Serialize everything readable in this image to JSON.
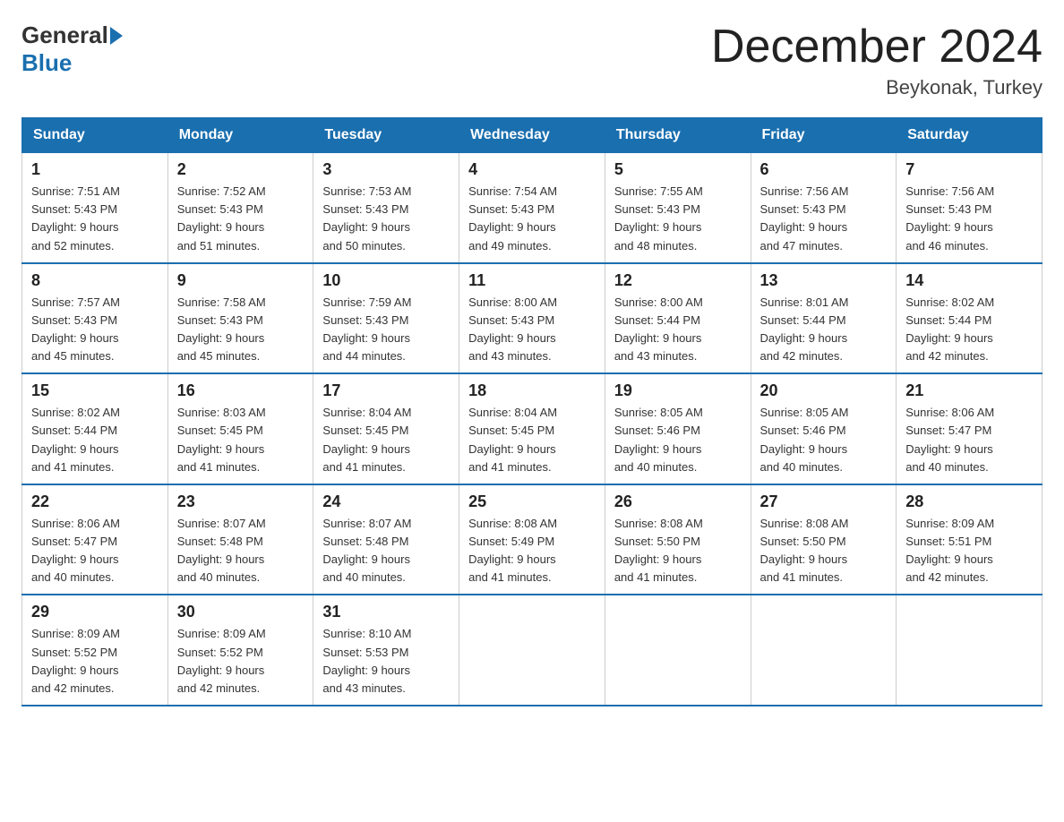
{
  "header": {
    "logo_general": "General",
    "logo_blue": "Blue",
    "month_title": "December 2024",
    "location": "Beykonak, Turkey"
  },
  "calendar": {
    "days_of_week": [
      "Sunday",
      "Monday",
      "Tuesday",
      "Wednesday",
      "Thursday",
      "Friday",
      "Saturday"
    ],
    "weeks": [
      [
        {
          "day": "1",
          "sunrise": "7:51 AM",
          "sunset": "5:43 PM",
          "daylight": "9 hours and 52 minutes."
        },
        {
          "day": "2",
          "sunrise": "7:52 AM",
          "sunset": "5:43 PM",
          "daylight": "9 hours and 51 minutes."
        },
        {
          "day": "3",
          "sunrise": "7:53 AM",
          "sunset": "5:43 PM",
          "daylight": "9 hours and 50 minutes."
        },
        {
          "day": "4",
          "sunrise": "7:54 AM",
          "sunset": "5:43 PM",
          "daylight": "9 hours and 49 minutes."
        },
        {
          "day": "5",
          "sunrise": "7:55 AM",
          "sunset": "5:43 PM",
          "daylight": "9 hours and 48 minutes."
        },
        {
          "day": "6",
          "sunrise": "7:56 AM",
          "sunset": "5:43 PM",
          "daylight": "9 hours and 47 minutes."
        },
        {
          "day": "7",
          "sunrise": "7:56 AM",
          "sunset": "5:43 PM",
          "daylight": "9 hours and 46 minutes."
        }
      ],
      [
        {
          "day": "8",
          "sunrise": "7:57 AM",
          "sunset": "5:43 PM",
          "daylight": "9 hours and 45 minutes."
        },
        {
          "day": "9",
          "sunrise": "7:58 AM",
          "sunset": "5:43 PM",
          "daylight": "9 hours and 45 minutes."
        },
        {
          "day": "10",
          "sunrise": "7:59 AM",
          "sunset": "5:43 PM",
          "daylight": "9 hours and 44 minutes."
        },
        {
          "day": "11",
          "sunrise": "8:00 AM",
          "sunset": "5:43 PM",
          "daylight": "9 hours and 43 minutes."
        },
        {
          "day": "12",
          "sunrise": "8:00 AM",
          "sunset": "5:44 PM",
          "daylight": "9 hours and 43 minutes."
        },
        {
          "day": "13",
          "sunrise": "8:01 AM",
          "sunset": "5:44 PM",
          "daylight": "9 hours and 42 minutes."
        },
        {
          "day": "14",
          "sunrise": "8:02 AM",
          "sunset": "5:44 PM",
          "daylight": "9 hours and 42 minutes."
        }
      ],
      [
        {
          "day": "15",
          "sunrise": "8:02 AM",
          "sunset": "5:44 PM",
          "daylight": "9 hours and 41 minutes."
        },
        {
          "day": "16",
          "sunrise": "8:03 AM",
          "sunset": "5:45 PM",
          "daylight": "9 hours and 41 minutes."
        },
        {
          "day": "17",
          "sunrise": "8:04 AM",
          "sunset": "5:45 PM",
          "daylight": "9 hours and 41 minutes."
        },
        {
          "day": "18",
          "sunrise": "8:04 AM",
          "sunset": "5:45 PM",
          "daylight": "9 hours and 41 minutes."
        },
        {
          "day": "19",
          "sunrise": "8:05 AM",
          "sunset": "5:46 PM",
          "daylight": "9 hours and 40 minutes."
        },
        {
          "day": "20",
          "sunrise": "8:05 AM",
          "sunset": "5:46 PM",
          "daylight": "9 hours and 40 minutes."
        },
        {
          "day": "21",
          "sunrise": "8:06 AM",
          "sunset": "5:47 PM",
          "daylight": "9 hours and 40 minutes."
        }
      ],
      [
        {
          "day": "22",
          "sunrise": "8:06 AM",
          "sunset": "5:47 PM",
          "daylight": "9 hours and 40 minutes."
        },
        {
          "day": "23",
          "sunrise": "8:07 AM",
          "sunset": "5:48 PM",
          "daylight": "9 hours and 40 minutes."
        },
        {
          "day": "24",
          "sunrise": "8:07 AM",
          "sunset": "5:48 PM",
          "daylight": "9 hours and 40 minutes."
        },
        {
          "day": "25",
          "sunrise": "8:08 AM",
          "sunset": "5:49 PM",
          "daylight": "9 hours and 41 minutes."
        },
        {
          "day": "26",
          "sunrise": "8:08 AM",
          "sunset": "5:50 PM",
          "daylight": "9 hours and 41 minutes."
        },
        {
          "day": "27",
          "sunrise": "8:08 AM",
          "sunset": "5:50 PM",
          "daylight": "9 hours and 41 minutes."
        },
        {
          "day": "28",
          "sunrise": "8:09 AM",
          "sunset": "5:51 PM",
          "daylight": "9 hours and 42 minutes."
        }
      ],
      [
        {
          "day": "29",
          "sunrise": "8:09 AM",
          "sunset": "5:52 PM",
          "daylight": "9 hours and 42 minutes."
        },
        {
          "day": "30",
          "sunrise": "8:09 AM",
          "sunset": "5:52 PM",
          "daylight": "9 hours and 42 minutes."
        },
        {
          "day": "31",
          "sunrise": "8:10 AM",
          "sunset": "5:53 PM",
          "daylight": "9 hours and 43 minutes."
        },
        null,
        null,
        null,
        null
      ]
    ]
  }
}
